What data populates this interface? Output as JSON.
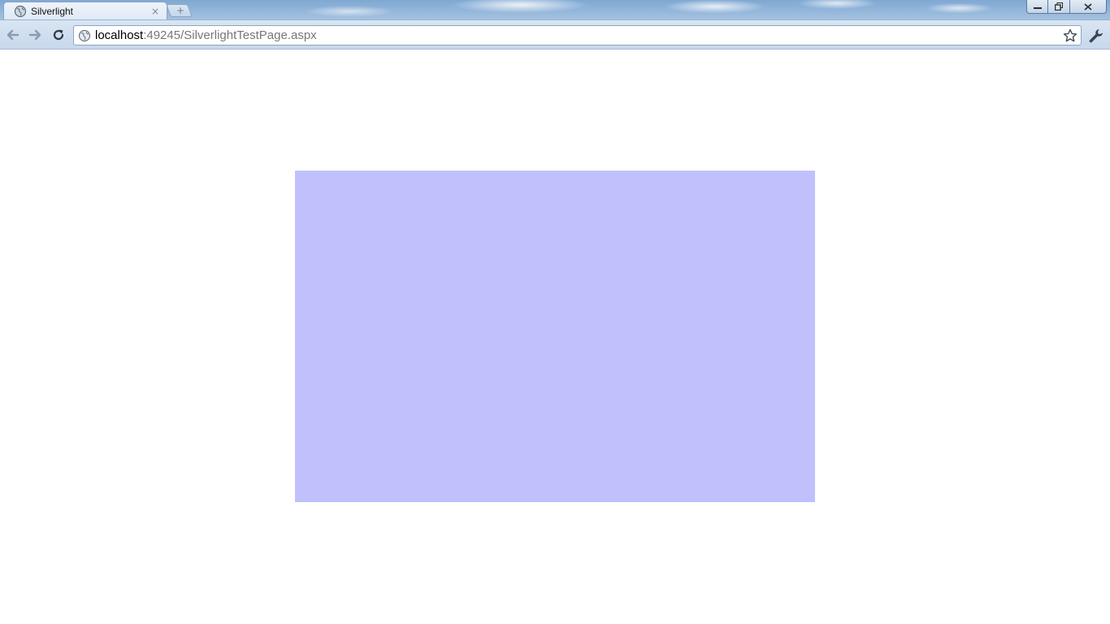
{
  "browser": {
    "tab": {
      "title": "Silverlight",
      "close_glyph": "×"
    },
    "new_tab_glyph": "+",
    "address": {
      "host": "localhost",
      "rest": ":49245/SilverlightTestPage.aspx"
    },
    "icons": {
      "favicon": "globe-icon",
      "back": "back-arrow-icon",
      "forward": "forward-arrow-icon",
      "reload": "reload-icon",
      "page_info": "globe-icon",
      "bookmark": "star-icon",
      "menu": "wrench-icon"
    },
    "window_controls": {
      "minimize": "minimize-icon",
      "maximize": "restore-icon",
      "close": "close-icon"
    }
  },
  "page": {
    "plugin_color": "#c0c0fd",
    "background_color": "#ffffff"
  }
}
